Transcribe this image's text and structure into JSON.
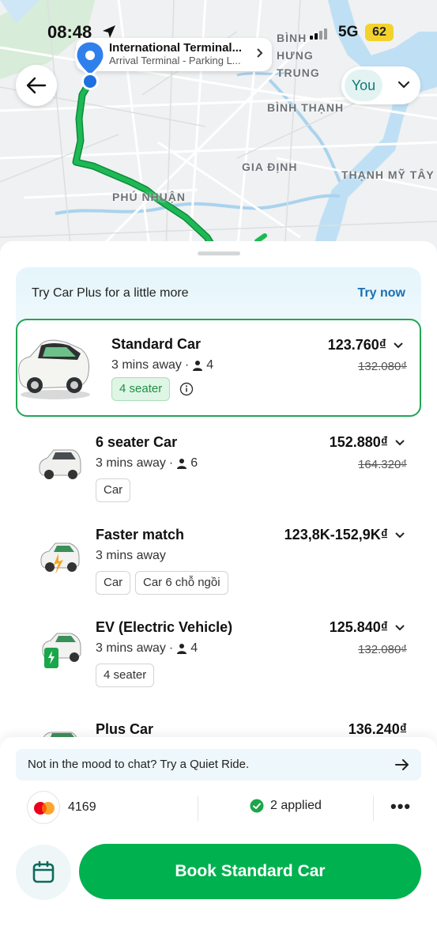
{
  "status_bar": {
    "time": "08:48",
    "network": "5G",
    "battery": "62"
  },
  "map": {
    "districts": [
      "BÌNH HƯNG TRUNG",
      "BÌNH THẠNH",
      "GIA ĐỊNH",
      "THẠNH MỸ TÂY",
      "PHÚ NHUẬN"
    ],
    "pickup": {
      "title": "International Terminal...",
      "subtitle": "Arrival Terminal - Parking L..."
    },
    "you_label": "You"
  },
  "promo": {
    "text": "Try Car Plus for a little more",
    "link": "Try now"
  },
  "options": [
    {
      "name": "Standard Car",
      "eta": "3 mins away",
      "seats": "4",
      "price": "123.760₫",
      "old_price": "132.080₫",
      "tags": [
        "4 seater"
      ],
      "selected": true
    },
    {
      "name": "6 seater Car",
      "eta": "3 mins away",
      "seats": "6",
      "price": "152.880₫",
      "old_price": "164.320₫",
      "tags": [
        "Car"
      ]
    },
    {
      "name": "Faster match",
      "eta": "3 mins away",
      "price": "123,8K-152,9K₫",
      "tags": [
        "Car",
        "Car 6 chỗ ngồi"
      ]
    },
    {
      "name": "EV (Electric Vehicle)",
      "eta": "3 mins away",
      "seats": "4",
      "price": "125.840₫",
      "old_price": "132.080₫",
      "tags": [
        "4 seater"
      ]
    },
    {
      "name": "Plus Car",
      "price": "136.240₫"
    }
  ],
  "quiet_ride": "Not in the mood to chat? Try a Quiet Ride.",
  "payment": {
    "card_last4": "4169",
    "promos_applied": "2 applied",
    "more": "•••"
  },
  "book_button": "Book Standard Car",
  "colors": {
    "brand_green": "#00b14f",
    "route_green": "#1db954",
    "link_blue": "#1a6fb0",
    "pin_blue": "#2f80ed"
  }
}
